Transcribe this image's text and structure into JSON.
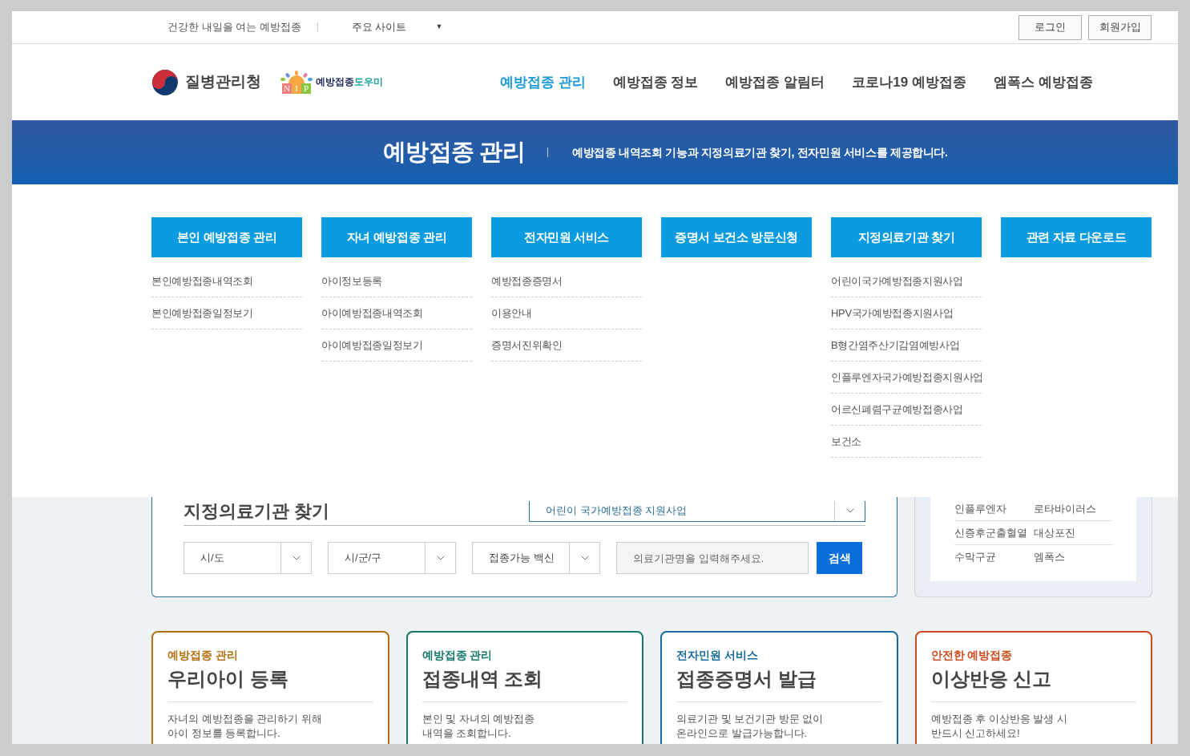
{
  "top_bar": {
    "slogan": "건강한 내일을 여는 예방접종",
    "site_select": "주요 사이트",
    "site_select_arrow": "▼",
    "buttons": [
      "로그인",
      "회원가입"
    ]
  },
  "header": {
    "agency": "질병관리청",
    "logo_letters": [
      "N",
      "I",
      "P"
    ],
    "site_name": [
      "예방접종",
      "도우미"
    ],
    "nav": [
      {
        "label": "예방접종 관리",
        "selected": true
      },
      {
        "label": "예방접종 정보",
        "selected": false
      },
      {
        "label": "예방접종 알림터",
        "selected": false
      },
      {
        "label": "코로나19 예방접종",
        "selected": false
      },
      {
        "label": "엠폭스 예방접종",
        "selected": false
      }
    ]
  },
  "banner": {
    "title": "예방접종 관리",
    "description": "예방접종 내역조회 기능과 지정의료기관 찾기, 전자민원 서비스를 제공합니다."
  },
  "mega_menu": [
    {
      "title": "본인 예방접종 관리",
      "items": [
        "본인예방접종내역조회",
        "본인예방접종일정보기"
      ]
    },
    {
      "title": "자녀 예방접종 관리",
      "items": [
        "아이정보등록",
        "아이예방접종내역조회",
        "아이예방접종일정보기"
      ]
    },
    {
      "title": "전자민원 서비스",
      "items": [
        "예방접종증명서",
        "이용안내",
        "증명서진위확인"
      ]
    },
    {
      "title": "증명서 보건소 방문신청"
    },
    {
      "title": "지정의료기관 찾기",
      "items": [
        "어린이국가예방접종지원사업",
        "HPV국가예방접종지원사업",
        "B형간염주산기감염예방사업",
        "인플루엔자국가예방접종지원사업",
        "어르신폐렴구균예방접종사업",
        "보건소"
      ]
    },
    {
      "title": "관련 자료 다운로드"
    }
  ],
  "clinic_search": {
    "title": "지정의료기관 찾기",
    "program_select": "어린이 국가예방접종 지원사업",
    "filters": [
      "시/도",
      "시/군/구",
      "접종가능 백신"
    ],
    "search": {
      "placeholder": "의료기관명을 입력해주세요."
    },
    "search_button": "검색"
  },
  "disease_list": [
    [
      "인플루엔자",
      "로타바이러스"
    ],
    [
      "신증후군출혈열",
      "대상포진"
    ],
    [
      "수막구균",
      "엠폭스"
    ]
  ],
  "service_cards": [
    {
      "category": "예방접종 관리",
      "title": "우리아이 등록",
      "description": [
        "자녀의 예방접종을 관리하기 위해",
        "아이 정보를 등록합니다."
      ],
      "color": "#b36f12"
    },
    {
      "category": "예방접종 관리",
      "title": "접종내역 조회",
      "description": [
        "본인 및 자녀의 예방접종",
        "내역을 조회합니다."
      ],
      "color": "#16786a"
    },
    {
      "category": "전자민원 서비스",
      "title": "접종증명서 발급",
      "description": [
        "의료기관 및 보건기관 방문 없이",
        "온라인으로 발급가능합니다."
      ],
      "color": "#176b9b"
    },
    {
      "category": "안전한 예방접종",
      "title": "이상반응 신고",
      "description": [
        "예방접종 후 이상반응 발생 시",
        "반드시 신고하세요!"
      ],
      "color": "#cc4a1c"
    }
  ]
}
